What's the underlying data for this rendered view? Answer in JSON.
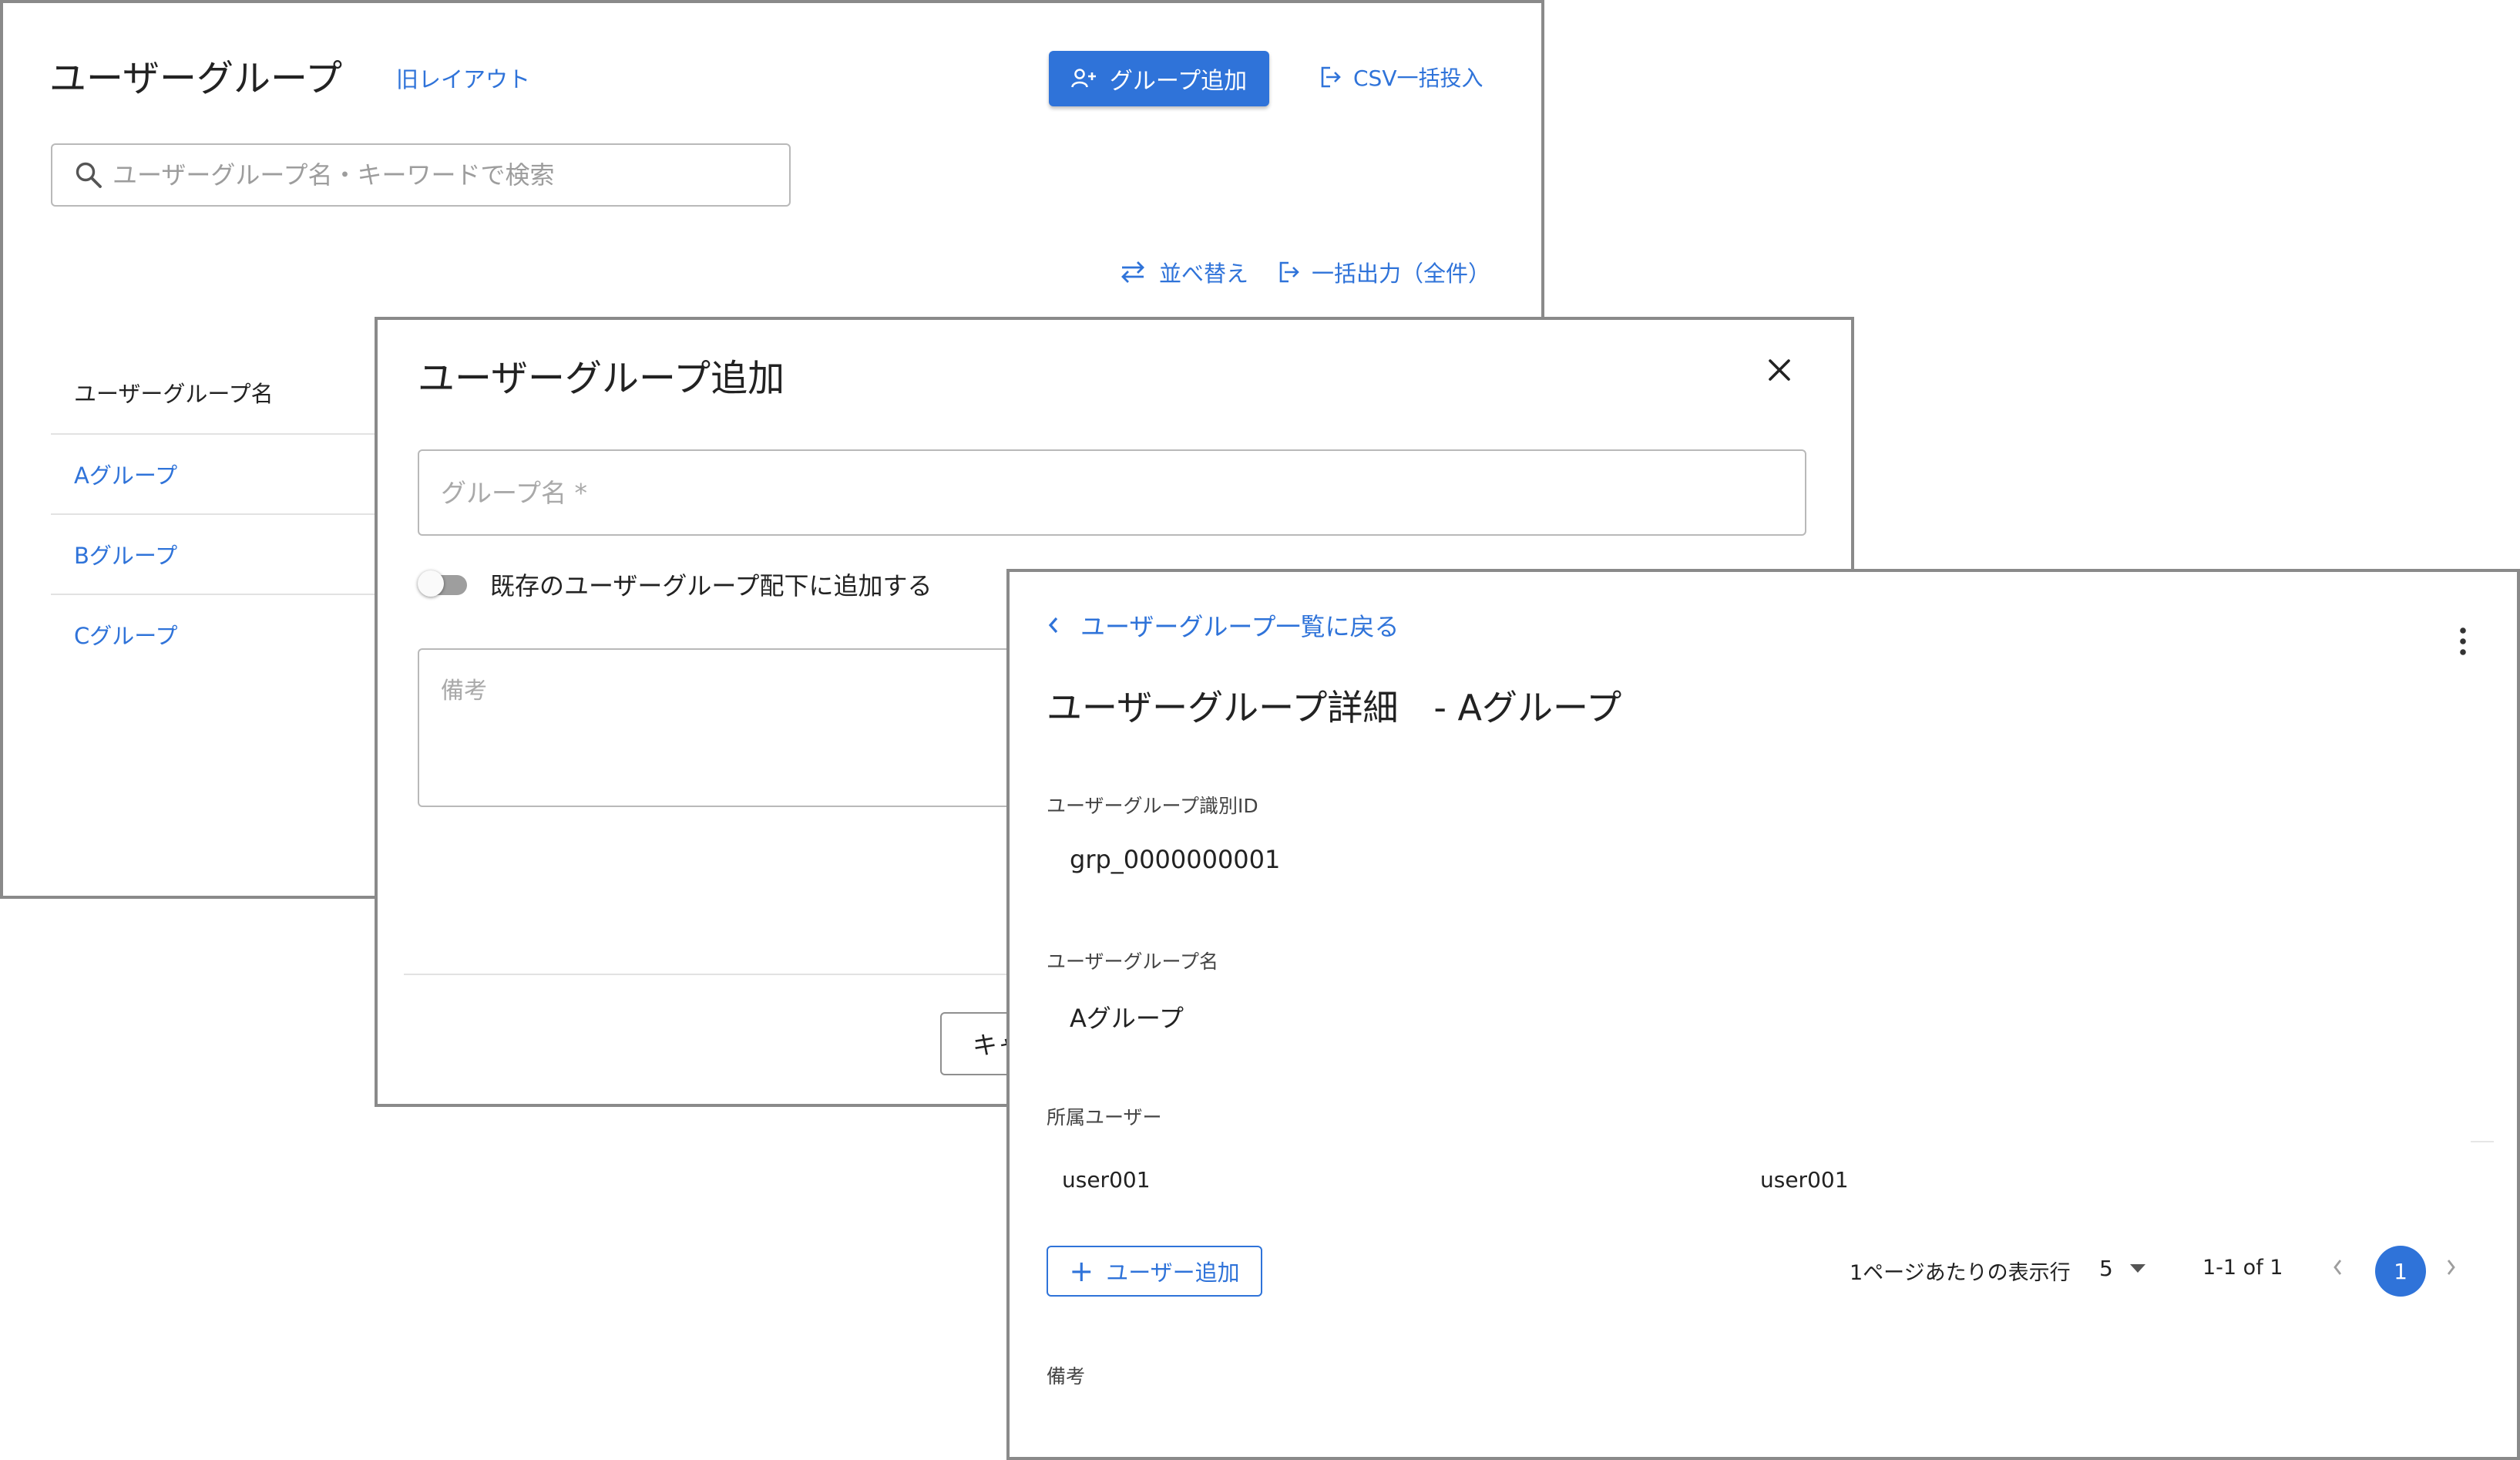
{
  "list_panel": {
    "title": "ユーザーグループ",
    "old_layout_link": "旧レイアウト",
    "add_group_button": "グループ追加",
    "csv_import_button": "CSV一括投入",
    "search_placeholder": "ユーザーグループ名・キーワードで検索",
    "sort_button": "並べ替え",
    "export_all_button": "一括出力（全件）",
    "column_header": "ユーザーグループ名",
    "rows": [
      "Aグループ",
      "Bグループ",
      "Cグループ"
    ]
  },
  "add_dialog": {
    "title": "ユーザーグループ追加",
    "group_name_placeholder": "グループ名 *",
    "toggle_label": "既存のユーザーグループ配下に追加する",
    "note_placeholder": "備考",
    "cancel_button": "キャ"
  },
  "detail_panel": {
    "back_link": "ユーザーグループ一覧に戻る",
    "title": "ユーザーグループ詳細　- Aグループ",
    "id_label": "ユーザーグループ識別ID",
    "id_value": "grp_0000000001",
    "name_label": "ユーザーグループ名",
    "name_value": "Aグループ",
    "members_label": "所属ユーザー",
    "members": [
      "user001",
      "user001"
    ],
    "add_user_button": "ユーザー追加",
    "rows_per_page_label": "1ページあたりの表示行",
    "rows_per_page_value": "5",
    "range_text": "1-1 of 1",
    "current_page": "1",
    "note_label": "備考"
  },
  "colors": {
    "accent": "#2f73d9",
    "border": "#8a8a8a",
    "text": "#222222",
    "placeholder": "#9d9d9d"
  }
}
